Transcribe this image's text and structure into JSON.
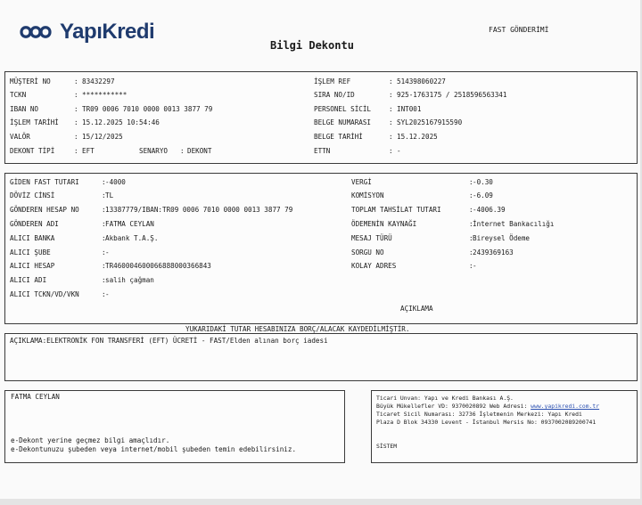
{
  "header": {
    "brand": "YapıKredi",
    "title": "Bilgi Dekontu",
    "type_label": "FAST GÖNDERİMİ"
  },
  "customer": {
    "left": [
      {
        "label": "MÜŞTERİ NO",
        "value": "83432297"
      },
      {
        "label": "TCKN",
        "value": "***********"
      },
      {
        "label": "IBAN NO",
        "value": "TR09 0006 7010 0000 0013 3877 79"
      },
      {
        "label": "İŞLEM TARİHİ",
        "value": "15.12.2025 10:54:46"
      },
      {
        "label": "VALÖR",
        "value": "15/12/2025"
      }
    ],
    "dekont_tipi_label": "DEKONT TİPİ",
    "dekont_tipi_value": "EFT",
    "senaryo_label": "SENARYO",
    "senaryo_value": "DEKONT",
    "right": [
      {
        "label": "İŞLEM REF",
        "value": "514398060227"
      },
      {
        "label": "SIRA NO/ID",
        "value": "925-1763175 / 2518596563341"
      },
      {
        "label": "PERSONEL SİCİL",
        "value": "INT001"
      },
      {
        "label": "BELGE NUMARASI",
        "value": "SYL2025167915590"
      },
      {
        "label": "BELGE TARİHİ",
        "value": "15.12.2025"
      },
      {
        "label": "ETTN",
        "value": "-"
      }
    ]
  },
  "transfer": {
    "left": [
      {
        "label": "GİDEN FAST TUTARI",
        "value": "-4000"
      },
      {
        "label": "DÖVİZ CİNSİ",
        "value": "TL"
      },
      {
        "label": "GÖNDEREN HESAP NO",
        "value": "13387779/IBAN:TR09 0006 7010 0000 0013 3877 79"
      },
      {
        "label": "GÖNDEREN ADI",
        "value": "FATMA CEYLAN"
      },
      {
        "label": "ALICI BANKA",
        "value": "Akbank T.A.Ş."
      },
      {
        "label": "ALICI ŞUBE",
        "value": "-"
      },
      {
        "label": "ALICI HESAP",
        "value": "TR460004600066888000366843"
      },
      {
        "label": "ALICI ADI",
        "value": "salih çağman"
      },
      {
        "label": "ALICI TCKN/VD/VKN",
        "value": "-"
      }
    ],
    "right": [
      {
        "label": "VERGİ",
        "value": "-0.30"
      },
      {
        "label": "KOMİSYON",
        "value": "-6.09"
      },
      {
        "label": "TOPLAM TAHSİLAT TUTARI",
        "value": "-4006.39"
      },
      {
        "label": "ÖDEMENİN KAYNAĞI",
        "value": "İnternet Bankacılığı"
      },
      {
        "label": "MESAJ TÜRÜ",
        "value": "Bireysel Ödeme"
      },
      {
        "label": "SORGU NO",
        "value": "2439369163"
      },
      {
        "label": "KOLAY ADRES",
        "value": "-"
      }
    ],
    "aciklama_heading": "AÇIKLAMA"
  },
  "notice": "YUKARIDAKİ TUTAR HESABINIZA BORÇ/ALACAK KAYDEDİLMİŞTİR.",
  "description": "AÇIKLAMA:ELEKTRONİK FON TRANSFERİ (EFT) ÜCRETİ - FAST/Elden alınan borç iadesi",
  "footer_left": {
    "name": "FATMA CEYLAN",
    "note1": "e-Dekont yerine geçmez bilgi amaçlıdır.",
    "note2": "e-Dekontunuzu şubeden veya internet/mobil şubeden temin edebilirsiniz."
  },
  "footer_right": {
    "line1": "Ticari Unvan: Yapı ve Kredi Bankası A.Ş.",
    "line2_prefix": "Büyük Mükellefler VD: 9370020892 Web Adresi: ",
    "line2_link": "www.yapikredi.com.tr",
    "line3": "Ticaret Sicil Numarası: 32736 İşletmenin Merkezi: Yapı Kredi",
    "line4": "Plaza D Blok 34330 Levent - İstanbul Mersis No: 0937002089200741",
    "sistem": "SİSTEM"
  },
  "colors": {
    "brand_blue": "#1f3b6e",
    "link_blue": "#2a4fb0",
    "border": "#3a3a3a"
  }
}
